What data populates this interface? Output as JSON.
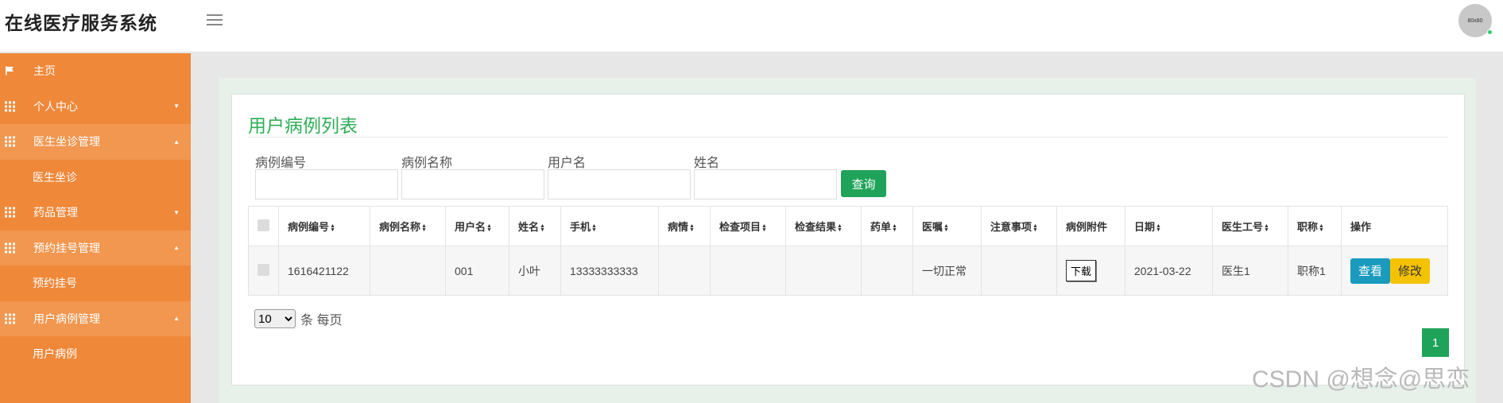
{
  "header": {
    "title": "在线医疗服务系统",
    "avatar_text": "80x80"
  },
  "sidebar": {
    "items": [
      {
        "label": "主页",
        "icon": "flag-icon"
      },
      {
        "label": "个人中心",
        "icon": "grid-icon",
        "caret": "▼"
      },
      {
        "label": "医生坐诊管理",
        "icon": "grid-icon",
        "caret": "▲"
      },
      {
        "label": "医生坐诊"
      },
      {
        "label": "药品管理",
        "icon": "grid-icon",
        "caret": "▼"
      },
      {
        "label": "预约挂号管理",
        "icon": "grid-icon",
        "caret": "▲"
      },
      {
        "label": "预约挂号"
      },
      {
        "label": "用户病例管理",
        "icon": "grid-icon",
        "caret": "▲"
      },
      {
        "label": "用户病例"
      }
    ]
  },
  "main": {
    "title": "用户病例列表",
    "filters": [
      {
        "label": "病例编号",
        "value": ""
      },
      {
        "label": "病例名称",
        "value": ""
      },
      {
        "label": "用户名",
        "value": ""
      },
      {
        "label": "姓名",
        "value": ""
      }
    ],
    "query_label": "查询",
    "columns": [
      "病例编号",
      "病例名称",
      "用户名",
      "姓名",
      "手机",
      "病情",
      "检查项目",
      "检查结果",
      "药单",
      "医嘱",
      "注意事项",
      "病例附件",
      "日期",
      "医生工号",
      "职称",
      "操作"
    ],
    "rows": [
      {
        "case_no": "1616421122",
        "case_name": "",
        "username": "001",
        "name": "小叶",
        "phone": "13333333333",
        "condition": "",
        "exam_items": "",
        "exam_result": "",
        "prescription": "",
        "advice": "一切正常",
        "notes": "",
        "attachment_label": "下载",
        "date": "2021-03-22",
        "doctor_id": "医生1",
        "title": "职称1",
        "view_label": "查看",
        "edit_label": "修改"
      }
    ],
    "page_size": "10",
    "page_size_suffix": "条 每页",
    "current_page": "1"
  },
  "watermark": "CSDN @想念@思恋",
  "colors": {
    "sidebar": "#f0883a",
    "accent_green": "#1fa35a",
    "view_btn": "#1a9bbd",
    "edit_btn": "#f5c200"
  }
}
